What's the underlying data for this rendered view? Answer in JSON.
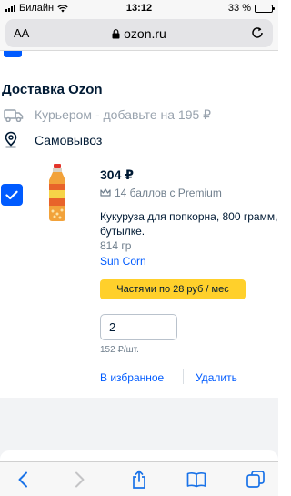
{
  "status_bar": {
    "carrier": "Билайн",
    "time": "13:12",
    "battery": "33 %",
    "battery_level": 0.33
  },
  "browser": {
    "text_size_label": "AA",
    "url": "ozon.ru"
  },
  "delivery": {
    "title": "Доставка Ozon",
    "courier_label": "Курьером - добавьте на 195 ₽",
    "pickup_label": "Самовывоз"
  },
  "cart_item": {
    "price": "304 ₽",
    "bonus": "14 баллов с Premium",
    "name": "Кукуруза для попкорна, 800 грамм, в бутылке.",
    "weight": "814 гр",
    "brand": "Sun Corn",
    "installments": "Частями по 28 руб / мес",
    "quantity": "2",
    "unit_price": "152 ₽/шт.",
    "favorite_label": "В избранное",
    "remove_label": "Удалить",
    "checked": true
  },
  "colors": {
    "accent": "#005bff",
    "installments_bg": "#ffd02b",
    "text": "#001a34",
    "muted": "#707f8d"
  },
  "toolbar_icons": [
    "back-icon",
    "forward-icon",
    "share-icon",
    "bookmarks-icon",
    "tabs-icon"
  ]
}
